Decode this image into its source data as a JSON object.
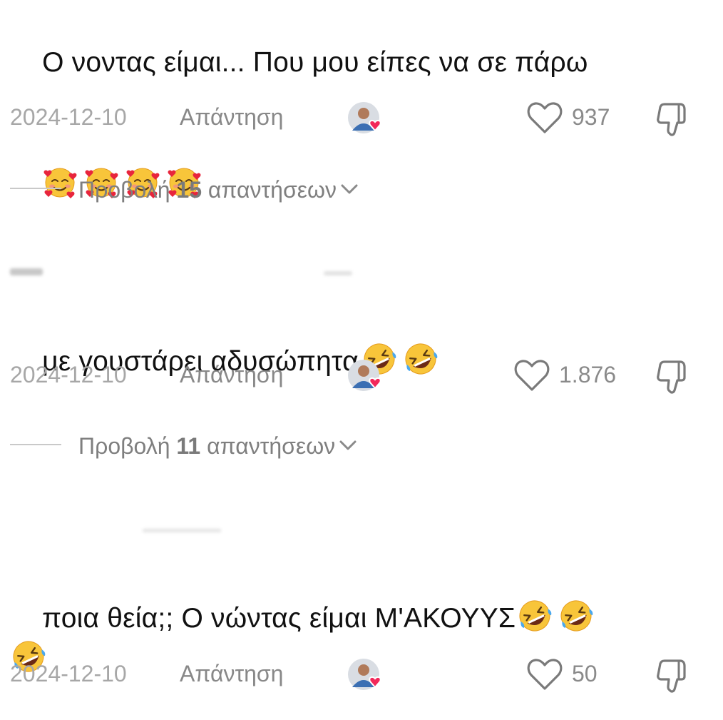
{
  "comments": [
    {
      "text": "Ο νοντας είμαι... Που μου είπες να σε πάρω",
      "emojis": [
        "smiling-face-with-hearts",
        "smiling-face-with-hearts",
        "smiling-face-with-hearts",
        "smiling-face-with-hearts"
      ],
      "date": "2024-12-10",
      "reply_label": "Απάντηση",
      "likes": "937",
      "replies": {
        "prefix": "Προβολή",
        "count": "15",
        "suffix": "απαντήσεων"
      }
    },
    {
      "text": "με γουστάρει αδυσώπητα",
      "emojis": [
        "rolling-on-floor-laughing",
        "rolling-on-floor-laughing"
      ],
      "date": "2024-12-10",
      "reply_label": "Απάντηση",
      "likes": "1.876",
      "replies": {
        "prefix": "Προβολή",
        "count": "11",
        "suffix": "απαντήσεων"
      }
    },
    {
      "text": "ποια θεία;; Ο νώντας είμαι Μ'ΑΚΟΥΥΣ",
      "emojis": [
        "rolling-on-floor-laughing",
        "rolling-on-floor-laughing",
        "rolling-on-floor-laughing"
      ],
      "date": "2024-12-10",
      "reply_label": "Απάντηση",
      "likes": "50"
    }
  ],
  "colors": {
    "text": "#111111",
    "meta": "#a7a7a7",
    "icon": "#7a7a7a",
    "heart_badge": "#f2285a"
  }
}
